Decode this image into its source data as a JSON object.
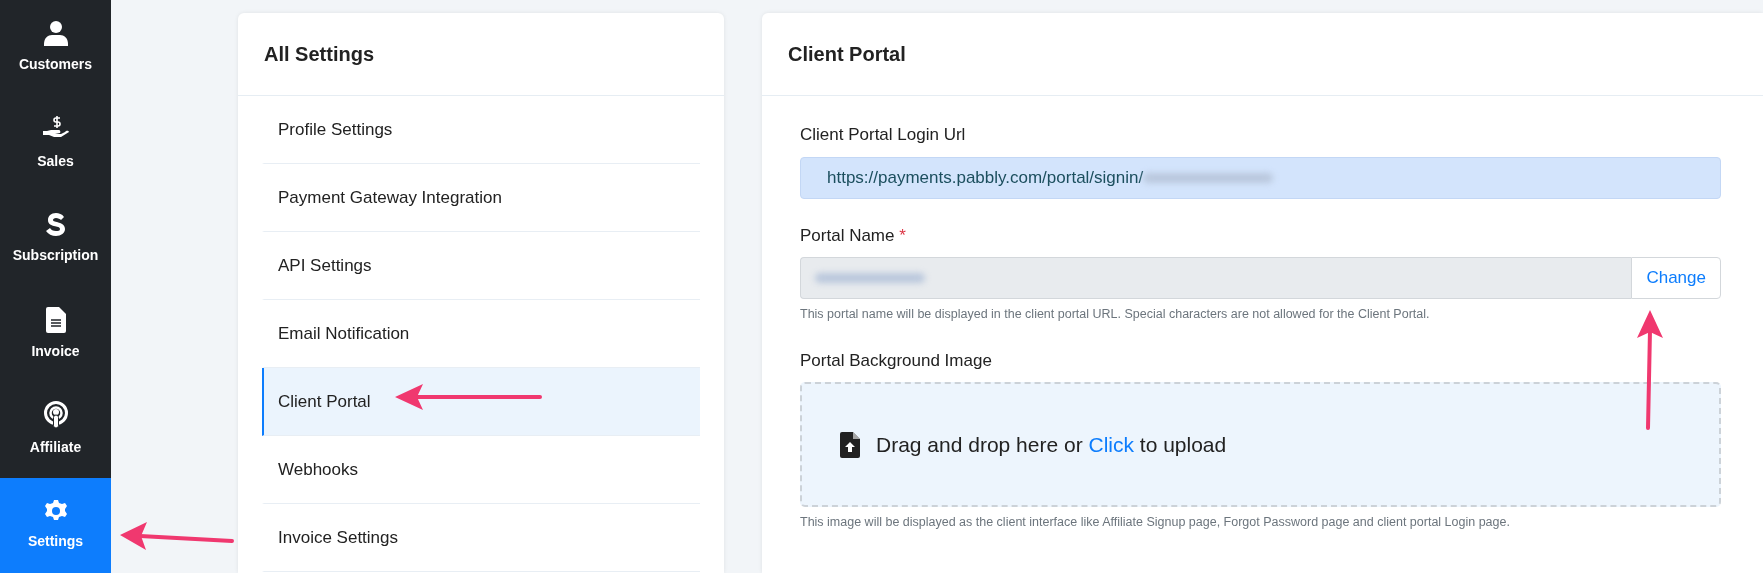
{
  "sidebar": {
    "items": [
      {
        "label": "Customers",
        "selected": false
      },
      {
        "label": "Sales",
        "selected": false
      },
      {
        "label": "Subscription",
        "selected": false
      },
      {
        "label": "Invoice",
        "selected": false
      },
      {
        "label": "Affiliate",
        "selected": false
      },
      {
        "label": "Settings",
        "selected": true
      }
    ]
  },
  "settings_menu": {
    "title": "All Settings",
    "items": [
      {
        "label": "Profile Settings",
        "selected": false
      },
      {
        "label": "Payment Gateway Integration",
        "selected": false
      },
      {
        "label": "API Settings",
        "selected": false
      },
      {
        "label": "Email Notification",
        "selected": false
      },
      {
        "label": "Client Portal",
        "selected": true
      },
      {
        "label": "Webhooks",
        "selected": false
      },
      {
        "label": "Invoice Settings",
        "selected": false
      }
    ]
  },
  "client_portal": {
    "title": "Client Portal",
    "login_url": {
      "label": "Client Portal Login Url",
      "value": "https://payments.pabbly.com/portal/signin/"
    },
    "portal_name": {
      "label": "Portal Name",
      "required_mark": "*",
      "button": "Change",
      "help": "This portal name will be displayed in the client portal URL. Special characters are not allowed for the Client Portal."
    },
    "background_image": {
      "label": "Portal Background Image",
      "dropzone_before": "Drag and drop here or",
      "dropzone_link": "Click",
      "dropzone_after": "to upload",
      "help": "This image will be displayed as the client interface like Affiliate Signup page, Forgot Password page and client portal Login page."
    }
  }
}
